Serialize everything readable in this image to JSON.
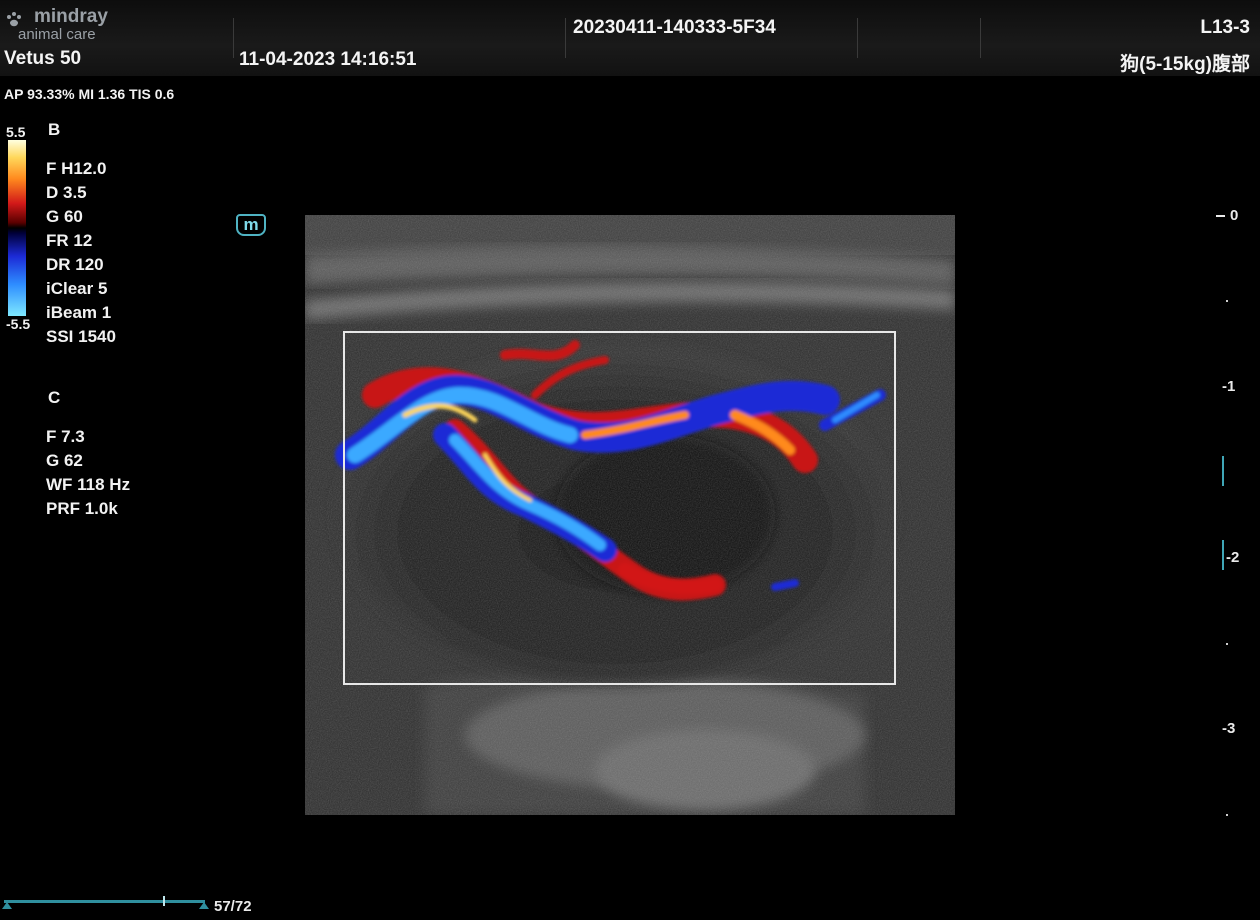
{
  "header": {
    "brand": "mindray",
    "brand_sub": "animal care",
    "model": "Vetus 50",
    "datetime": "11-04-2023  14:16:51",
    "exam_id": "20230411-140333-5F34",
    "probe": "L13-3",
    "preset": "狗(5-15kg)腹部"
  },
  "acoustic": "AP 93.33%  MI 1.36 TIS 0.6",
  "colorbar": {
    "max": "5.5",
    "min": "-5.5"
  },
  "b_mode": {
    "title": "B",
    "params": [
      "F H12.0",
      "D 3.5",
      "G 60",
      "FR 12",
      "DR 120",
      "iClear 5",
      "iBeam 1",
      "SSI 1540"
    ]
  },
  "c_mode": {
    "title": "C",
    "params": [
      "F 7.3",
      "G 62",
      "WF 118 Hz",
      "PRF 1.0k"
    ]
  },
  "m_icon": "m",
  "depth_scale": [
    "0",
    "1",
    "2",
    "3"
  ],
  "cine": {
    "counter": "57/72",
    "current": 57,
    "total": 72
  },
  "colors": {
    "accent": "#2f8f9e",
    "roi": "#e8e8e8"
  }
}
